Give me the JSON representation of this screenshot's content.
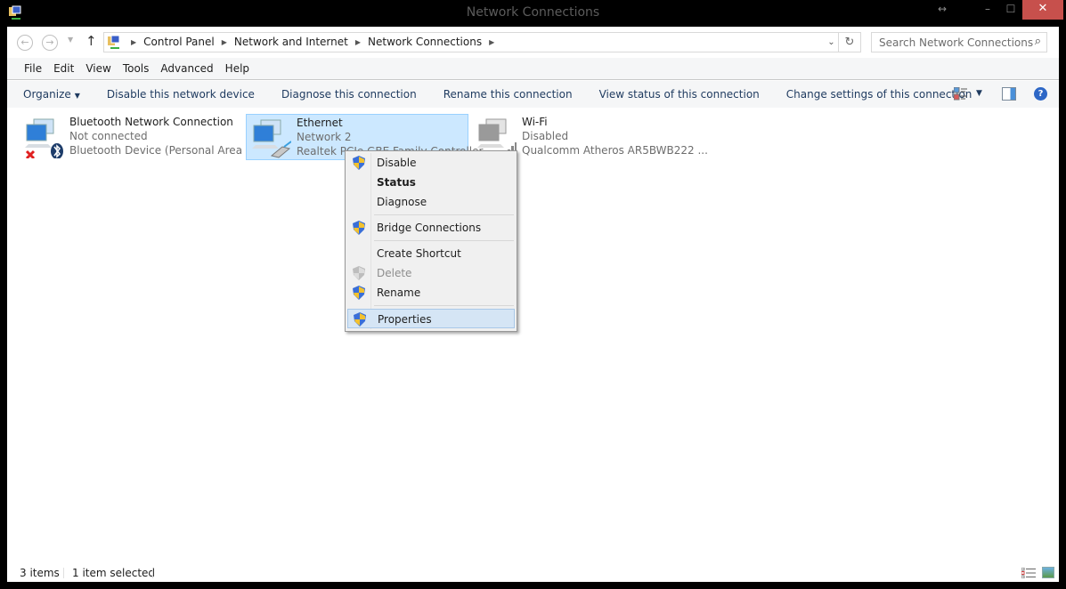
{
  "window": {
    "title": "Network Connections",
    "controls": {
      "resize": "↔",
      "minimize": "–",
      "maximize": "☐",
      "close": "✕"
    }
  },
  "address_bar": {
    "back_icon": "←",
    "forward_icon": "→",
    "recent_icon": "▼",
    "up_icon": "↑",
    "breadcrumbs": [
      "Control Panel",
      "Network and Internet",
      "Network Connections"
    ],
    "separator": "▶",
    "dropdown_icon": "⌄",
    "refresh_icon": "↻"
  },
  "search": {
    "placeholder": "Search Network Connections",
    "icon": "⌕"
  },
  "menubar": {
    "items": [
      "File",
      "Edit",
      "View",
      "Tools",
      "Advanced",
      "Help"
    ]
  },
  "command_bar": {
    "organize": "Organize",
    "caret": "▼",
    "commands": [
      "Disable this network device",
      "Diagnose this connection",
      "Rename this connection",
      "View status of this connection",
      "Change settings of this connection"
    ],
    "help_icon": "?"
  },
  "connections": [
    {
      "name": "Bluetooth Network Connection",
      "status": "Not connected",
      "device": "Bluetooth Device (Personal Area ...",
      "selected": false
    },
    {
      "name": "Ethernet",
      "status": "Network  2",
      "device": "Realtek PCIe GBE Family Controller",
      "selected": true
    },
    {
      "name": "Wi-Fi",
      "status": "Disabled",
      "device": "Qualcomm Atheros AR5BWB222 ...",
      "selected": false
    }
  ],
  "context_menu": {
    "items": [
      {
        "label": "Disable",
        "shield": true,
        "bold": false,
        "disabled": false
      },
      {
        "label": "Status",
        "shield": false,
        "bold": true,
        "disabled": false
      },
      {
        "label": "Diagnose",
        "shield": false,
        "bold": false,
        "disabled": false
      },
      {
        "label": "Bridge Connections",
        "shield": true,
        "bold": false,
        "disabled": false
      },
      {
        "label": "Create Shortcut",
        "shield": false,
        "bold": false,
        "disabled": false
      },
      {
        "label": "Delete",
        "shield": true,
        "bold": false,
        "disabled": true
      },
      {
        "label": "Rename",
        "shield": true,
        "bold": false,
        "disabled": false
      },
      {
        "label": "Properties",
        "shield": true,
        "bold": false,
        "disabled": false,
        "highlighted": true
      }
    ]
  },
  "statusbar": {
    "item_count": "3 items",
    "selection": "1 item selected"
  }
}
